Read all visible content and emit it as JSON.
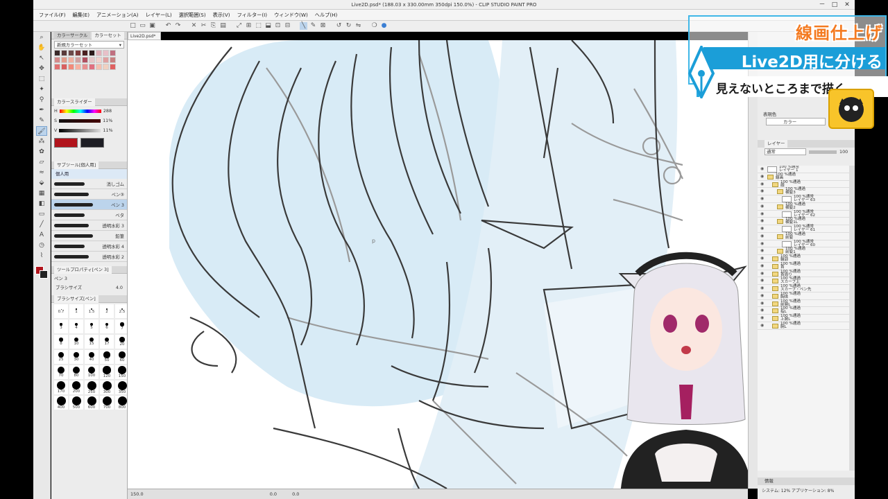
{
  "window": {
    "title": "Live2D.psd* (188.03 x 330.00mm 350dpi 150.0%) - CLIP STUDIO PAINT PRO",
    "min": "－",
    "max": "□",
    "close": "✕"
  },
  "menu": [
    "ファイル(F)",
    "編集(E)",
    "アニメーション(A)",
    "レイヤー(L)",
    "選択範囲(S)",
    "表示(V)",
    "フィルター(I)",
    "ウィンドウ(W)",
    "ヘルプ(H)"
  ],
  "document_tab": {
    "label": "Live2D.psd*",
    "close": "×"
  },
  "color_set": {
    "tabs": [
      "カラーサークル",
      "カラーセット"
    ],
    "selected": "新規カラーセット",
    "swatches": [
      "#3a2a2a",
      "#5a3b3b",
      "#6b4a4a",
      "#7b3a3a",
      "#4a2020",
      "#2a1a1a",
      "#e0b0b8",
      "#e8c0c8",
      "#c07080",
      "#d48a8a",
      "#e29c8c",
      "#f0b0a0",
      "#d0a0a0",
      "#b05060",
      "#e5c6c6",
      "#f2d2cc",
      "#e0a0a0",
      "#c88080",
      "#e07070",
      "#d86060",
      "#f28a7a",
      "#f7b0a0",
      "#e89090",
      "#e07080",
      "#f4c0b0",
      "#f0d0c0",
      "#e06060"
    ]
  },
  "color_slider": {
    "tab": "カラースライダー",
    "h_label": "H",
    "h_value": "288",
    "s_label": "S",
    "s_value": "11%",
    "v_label": "V",
    "v_value": "11%",
    "fg_color": "#b1141c",
    "bg_color": "#1e1e24"
  },
  "subtool": {
    "tab": "サブツール[個人用]",
    "group": "個人用",
    "items": [
      "消しゴム",
      "ペン③",
      "ペン 3",
      "ベタ",
      "透明水彩 3",
      "鉛筆",
      "透明水彩 4",
      "透明水彩 2"
    ]
  },
  "tool_property": {
    "tab": "ツールプロパティ[ペン 3]",
    "title": "ペン 3",
    "brush_size_label": "ブラシサイズ",
    "brush_size_value": "4.0"
  },
  "brush_size_panel": {
    "tab": "ブラシサイズ[ペン]",
    "sizes": [
      "0.7",
      "1",
      "1.5",
      "2",
      "2.5",
      "3",
      "4",
      "5",
      "6",
      "7",
      "8",
      "10",
      "15",
      "17",
      "20",
      "25",
      "30",
      "40",
      "50",
      "60",
      "70",
      "80",
      "100",
      "120",
      "150",
      "170",
      "200",
      "250",
      "300",
      "350",
      "400",
      "500",
      "600",
      "700",
      "800"
    ]
  },
  "status": {
    "zoom": "150.0",
    "coords": "0.0",
    "angle": "0.0"
  },
  "right_panel": {
    "expression_label": "表現色",
    "expression_value": "カラー",
    "layer_tab": "レイヤー",
    "blend_mode": "通常",
    "opacity": "100",
    "layers": [
      {
        "name": "100 %通常",
        "sub": "レイヤー 1",
        "type": "layer",
        "indent": 0
      },
      {
        "name": "100 %通過",
        "sub": "線画",
        "type": "folder",
        "indent": 0
      },
      {
        "name": "100 %通過",
        "sub": "顔",
        "type": "folder",
        "indent": 1
      },
      {
        "name": "100 %通過",
        "sub": "横髪3",
        "type": "folder",
        "indent": 2
      },
      {
        "name": "100 %通常",
        "sub": "レイヤー 63",
        "type": "layer",
        "indent": 3
      },
      {
        "name": "100 %通過",
        "sub": "横髪2",
        "type": "folder",
        "indent": 2
      },
      {
        "name": "100 %通常",
        "sub": "レイヤー 62",
        "type": "layer",
        "indent": 3
      },
      {
        "name": "100 %通過",
        "sub": "横髪1L",
        "type": "folder",
        "indent": 2
      },
      {
        "name": "100 %通常",
        "sub": "レイヤー 61",
        "type": "layer",
        "indent": 3
      },
      {
        "name": "100 %通過",
        "sub": "前髪",
        "type": "folder",
        "indent": 2
      },
      {
        "name": "100 %通常",
        "sub": "レイヤー 60",
        "type": "layer",
        "indent": 3
      },
      {
        "name": "100 %通過",
        "sub": "前髪1",
        "type": "folder",
        "indent": 2
      },
      {
        "name": "100 %通過",
        "sub": "輪郭",
        "type": "folder",
        "indent": 1
      },
      {
        "name": "100 %通過",
        "sub": "首",
        "type": "folder",
        "indent": 1
      },
      {
        "name": "100 %通過",
        "sub": "首周り",
        "type": "folder",
        "indent": 1
      },
      {
        "name": "100 %通過",
        "sub": "スカーフ上",
        "type": "folder",
        "indent": 1
      },
      {
        "name": "100 %通過",
        "sub": "スカーフ・ペン先",
        "type": "folder",
        "indent": 1
      },
      {
        "name": "100 %通過",
        "sub": "胸体",
        "type": "folder",
        "indent": 1
      },
      {
        "name": "100 %通過",
        "sub": "前腕L",
        "type": "folder",
        "indent": 1
      },
      {
        "name": "100 %通過",
        "sub": "指L",
        "type": "folder",
        "indent": 1
      },
      {
        "name": "100 %通過",
        "sub": "上腕L",
        "type": "folder",
        "indent": 1
      },
      {
        "name": "100 %通過",
        "sub": "腕L",
        "type": "folder",
        "indent": 1
      }
    ],
    "info_tab": "情報",
    "system_text": "システム: 12%  アプリケーション: 8%"
  },
  "overlay": {
    "title": "線画仕上げ",
    "subtitle": "Live2D用に分ける",
    "note": "見えないところまで描く"
  },
  "colors": {
    "canvas_fill": "#d8ebf6",
    "line": "#3a3a3a",
    "sketch": "#9a9a9a",
    "accent_blue": "#1b9ed8",
    "accent_orange": "#f47a20"
  }
}
